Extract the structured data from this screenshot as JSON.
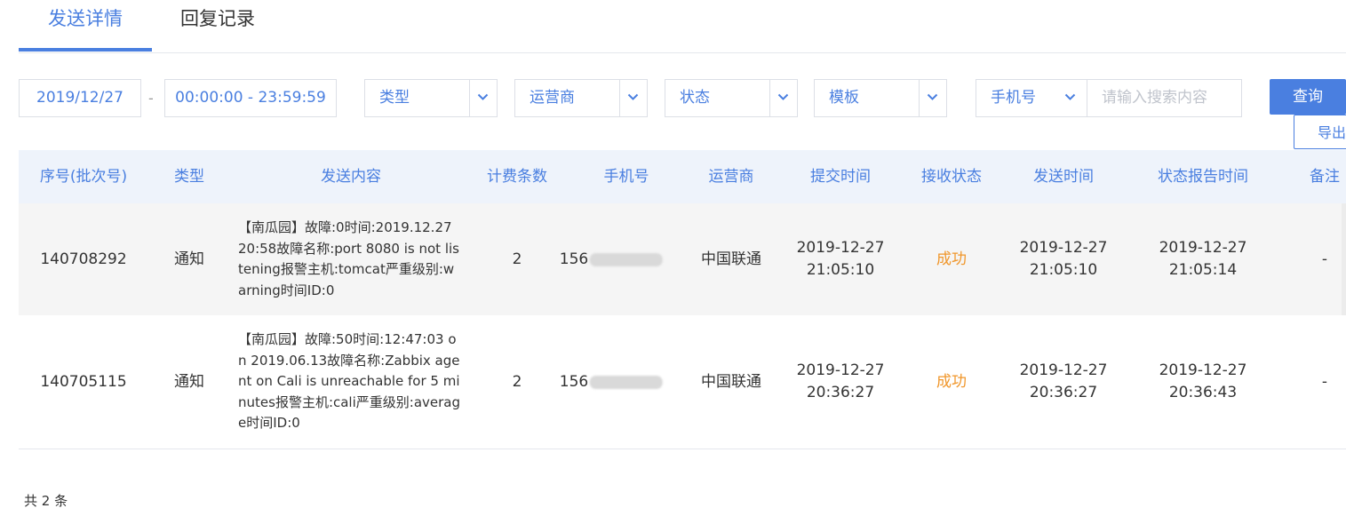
{
  "tabs": {
    "detail": "发送详情",
    "reply": "回复记录"
  },
  "filters": {
    "date": "2019/12/27",
    "separator": "-",
    "time_range": "00:00:00 - 23:59:59",
    "type": "类型",
    "carrier": "运营商",
    "status": "状态",
    "template": "模板",
    "search_field": "手机号",
    "search_placeholder": "请输入搜索内容",
    "query_button": "查询",
    "export_button": "导出"
  },
  "table": {
    "headers": [
      "序号(批次号)",
      "类型",
      "发送内容",
      "计费条数",
      "手机号",
      "运营商",
      "提交时间",
      "接收状态",
      "发送时间",
      "状态报告时间",
      "备注"
    ],
    "rows": [
      {
        "id": "140708292",
        "type": "通知",
        "content": "【南瓜园】故障:0时间:2019.12.27 20:58故障名称:port 8080 is not listening报警主机:tomcat严重级别:warning时间ID:0",
        "count": "2",
        "phone": "156",
        "carrier": "中国联通",
        "submit_date": "2019-12-27",
        "submit_time": "21:05:10",
        "status": "成功",
        "send_date": "2019-12-27",
        "send_time": "21:05:10",
        "report_date": "2019-12-27",
        "report_time": "21:05:14",
        "remark": "-"
      },
      {
        "id": "140705115",
        "type": "通知",
        "content": "【南瓜园】故障:50时间:12:47:03 on 2019.06.13故障名称:Zabbix agent on Cali is unreachable for 5 minutes报警主机:cali严重级别:average时间ID:0",
        "count": "2",
        "phone": "156",
        "carrier": "中国联通",
        "submit_date": "2019-12-27",
        "submit_time": "20:36:27",
        "status": "成功",
        "send_date": "2019-12-27",
        "send_time": "20:36:27",
        "report_date": "2019-12-27",
        "report_time": "20:36:43",
        "remark": "-"
      }
    ]
  },
  "footer": {
    "total": "共 2 条"
  },
  "colors": {
    "accent": "#4a7fe0",
    "success": "#f0962a",
    "header_bg": "#eef3fb"
  },
  "icons": {
    "dropdown": "chevron-down-icon"
  }
}
